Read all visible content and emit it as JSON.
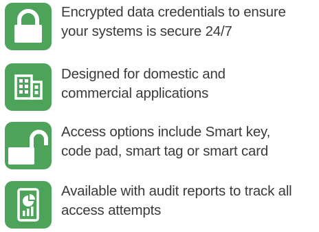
{
  "colors": {
    "icon_background": "#4ea35a",
    "icon_foreground": "#ffffff",
    "text": "#3a3a3a"
  },
  "features": [
    {
      "icon": "padlock-icon",
      "lines": [
        "Encrypted data credentials to ensure",
        "your systems is secure 24/7"
      ]
    },
    {
      "icon": "building-icon",
      "lines": [
        "Designed for domestic and",
        "commercial applications"
      ]
    },
    {
      "icon": "unlocked-padlock-icon",
      "lines": [
        "Access options include Smart key,",
        "code pad, smart tag or smart card"
      ]
    },
    {
      "icon": "audit-report-icon",
      "lines": [
        "Available with audit reports to track all",
        "access attempts"
      ]
    }
  ]
}
